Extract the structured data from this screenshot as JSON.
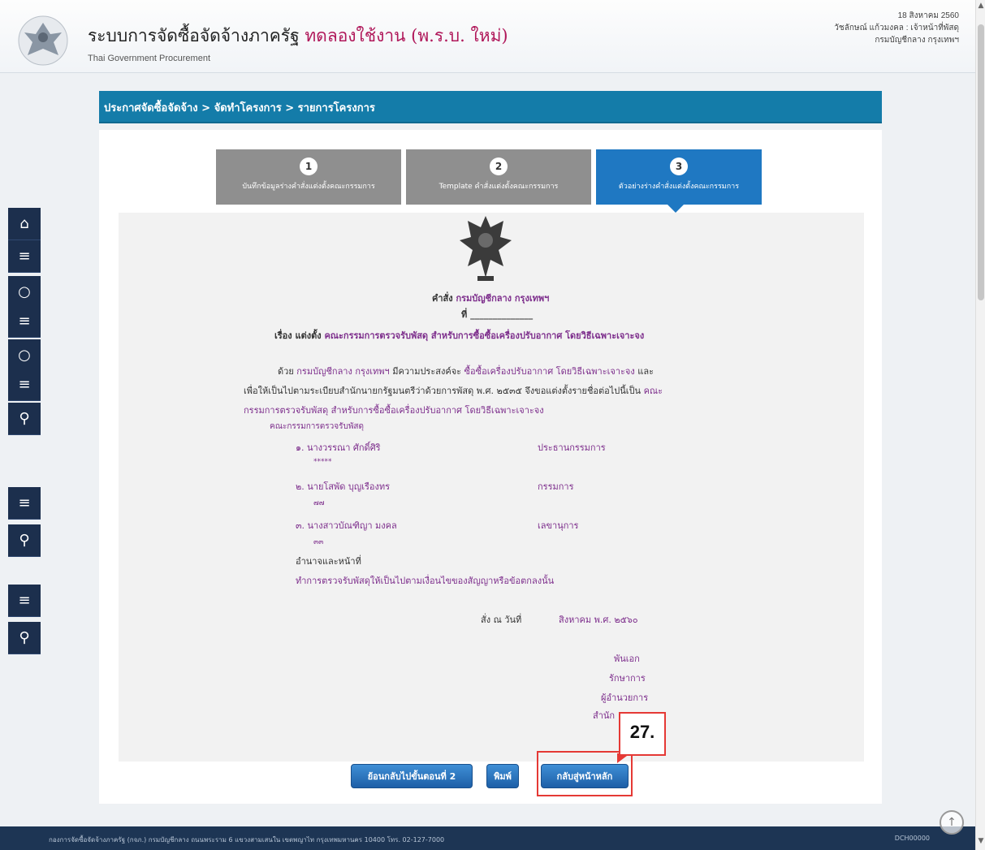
{
  "header": {
    "system_title": "ระบบการจัดซื้อจัดจ้างภาครัฐ",
    "trial_label": "ทดลองใช้งาน (พ.ร.บ. ใหม่)",
    "subtitle": "Thai Government Procurement",
    "date": "18 สิงหาคม 2560",
    "user_line": "วัชลักษณ์ แก้วมงคล : เจ้าหน้าที่พัสดุ",
    "agency": "กรมบัญชีกลาง กรุงเทพฯ"
  },
  "breadcrumb": "ประกาศจัดซื้อจัดจ้าง > จัดทำโครงการ > รายการโครงการ",
  "steps": [
    {
      "num": "1",
      "label": "บันทึกข้อมูลร่างคำสั่งแต่งตั้งคณะกรรมการ"
    },
    {
      "num": "2",
      "label": "Template คำสั่งแต่งตั้งคณะกรรมการ"
    },
    {
      "num": "3",
      "label": "ตัวอย่างร่างคำสั่งแต่งตั้งคณะกรรมการ"
    }
  ],
  "document": {
    "order_prefix": "คำสั่ง",
    "order_agency": "กรมบัญชีกลาง กรุงเทพฯ",
    "number_prefix": "ที่",
    "subject_prefix": "เรื่อง แต่งตั้ง",
    "subject": "คณะกรรมการตรวจรับพัสดุ สำหรับการซื้อซื้อเครื่องปรับอากาศ โดยวิธีเฉพาะเจาะจง",
    "para1_a": "ด้วย",
    "para1_agency": "กรมบัญชีกลาง กรุงเทพฯ",
    "para1_b": "มีความประสงค์จะ",
    "para1_item": "ซื้อซื้อเครื่องปรับอากาศ โดยวิธีเฉพาะเจาะจง",
    "para1_c": "และ",
    "para2_a": "เพื่อให้เป็นไปตามระเบียบสำนักนายกรัฐมนตรีว่าด้วยการพัสดุ พ.ศ. ๒๕๓๕ จึงขอแต่งตั้งรายชื่อต่อไปนี้เป็น",
    "para2_b": "คณะ",
    "para3": "กรรมการตรวจรับพัสดุ สำหรับการซื้อซื้อเครื่องปรับอากาศ โดยวิธีเฉพาะเจาะจง",
    "committee_heading": "คณะกรรมการตรวจรับพัสดุ",
    "members": [
      {
        "name": "๑. นางวรรณา ศักดิ์ศิริ",
        "role": "ประธานกรรมการ",
        "extra": "*****"
      },
      {
        "name": "๒. นายโสพัด บุญเรืองทร",
        "role": "กรรมการ",
        "extra": "๗๗"
      },
      {
        "name": "๓. นางสาวบัณฑิญา มงคล",
        "role": "เลขานุการ",
        "extra": "๓๓"
      }
    ],
    "duty_heading": "อำนาจและหน้าที่",
    "duty_text": "ทำการตรวจรับพัสดุให้เป็นไปตามเงื่อนไขของสัญญาหรือข้อตกลงนั้น",
    "sign_date_label": "สั่ง ณ วันที่",
    "sign_date": "สิงหาคม พ.ศ. ๒๕๖๐",
    "signer_lines": [
      "พันเอก",
      "รักษาการ",
      "ผู้อำนวยการ",
      "สำนัก"
    ]
  },
  "buttons": {
    "back": "ย้อนกลับไปขั้นตอนที่ 2",
    "print": "พิมพ์",
    "home": "กลับสู่หน้าหลัก"
  },
  "callout": "27.",
  "footer": {
    "text": "กองการจัดซื้อจัดจ้างภาครัฐ (กจภ.) กรมบัญชีกลาง ถนนพระราม 6 แขวงสามเสนใน เขตพญาไท กรุงเทพมหานคร 10400 โทร. 02-127-7000",
    "code": "DCH00000"
  }
}
